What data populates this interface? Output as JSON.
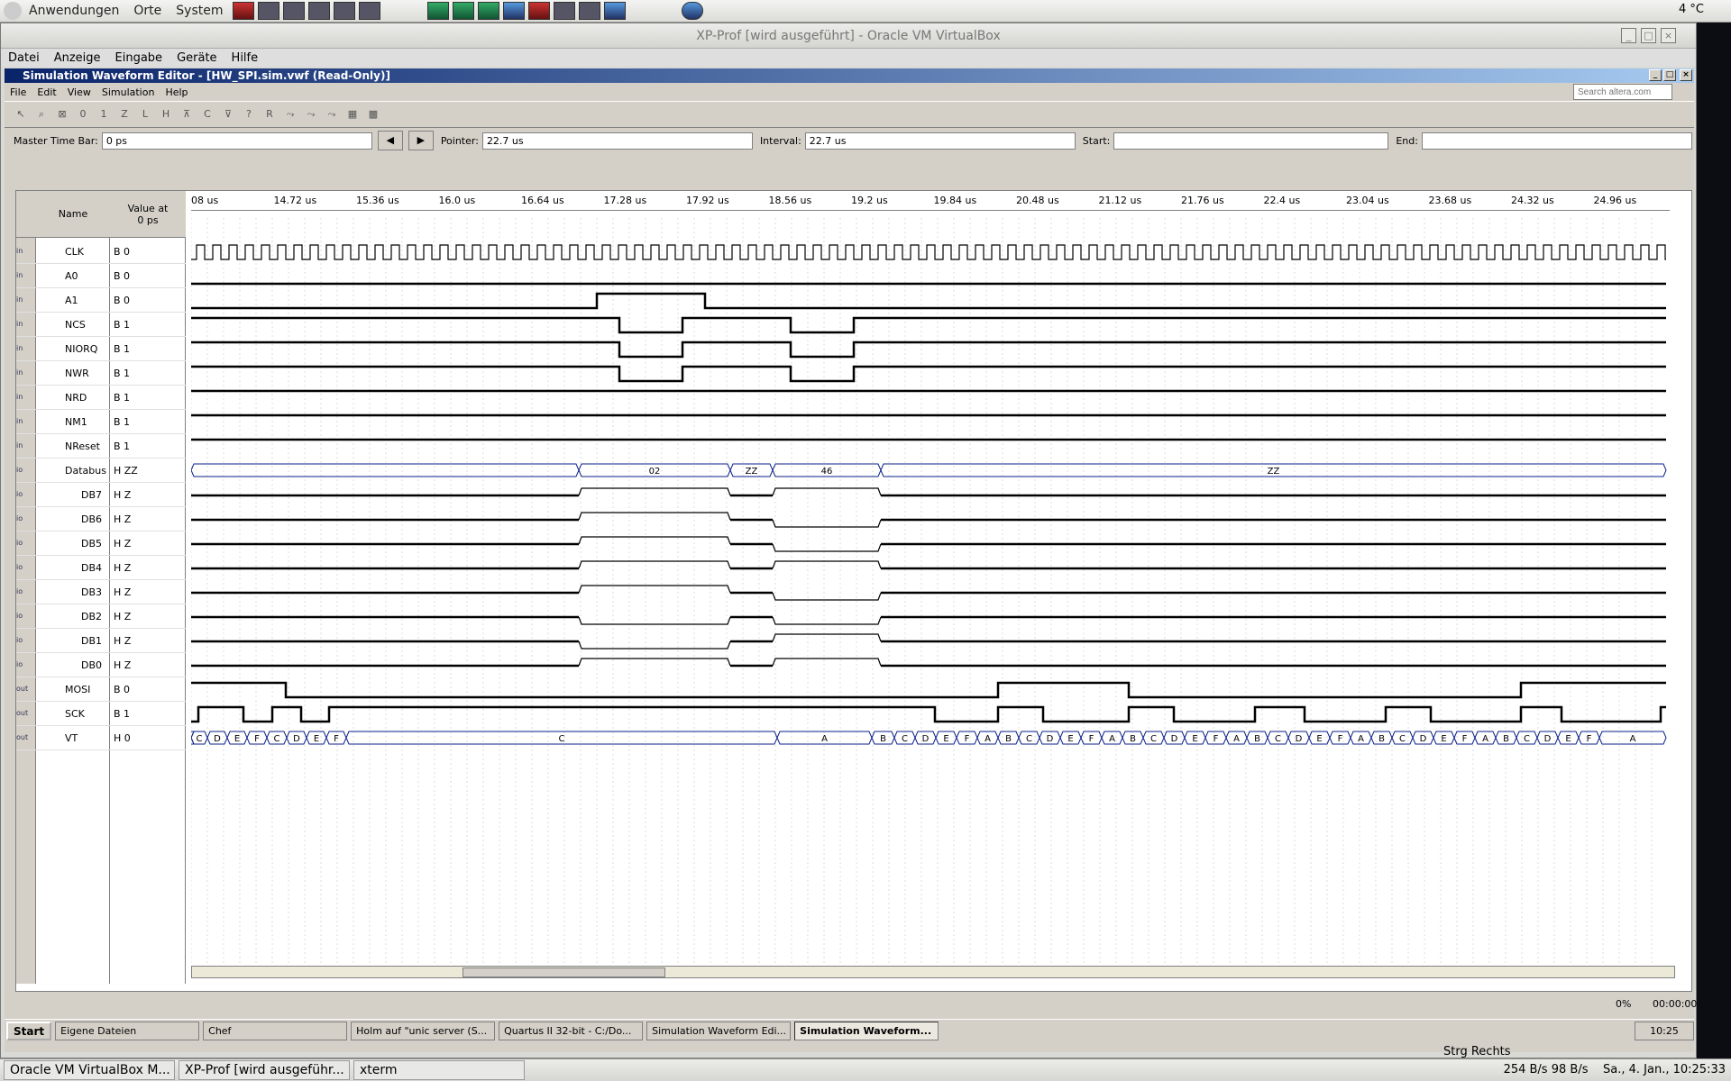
{
  "gnome_top": {
    "menus": [
      "Anwendungen",
      "Orte",
      "System"
    ],
    "weather": "4 °C"
  },
  "vbox": {
    "title": "XP-Prof [wird ausgeführt] - Oracle VM VirtualBox",
    "menu": [
      "Datei",
      "Anzeige",
      "Eingabe",
      "Geräte",
      "Hilfe"
    ],
    "status_right": "Strg Rechts"
  },
  "app": {
    "title": "Simulation Waveform Editor - [HW_SPI.sim.vwf (Read-Only)]",
    "menu": [
      "File",
      "Edit",
      "View",
      "Simulation",
      "Help"
    ],
    "search_placeholder": "Search altera.com"
  },
  "timebar": {
    "master_label": "Master Time Bar:",
    "master_value": "0 ps",
    "pointer_label": "Pointer:",
    "pointer_value": "22.7 us",
    "interval_label": "Interval:",
    "interval_value": "22.7 us",
    "start_label": "Start:",
    "end_label": "End:"
  },
  "table": {
    "name_header": "Name",
    "value_header": "Value at\n0 ps"
  },
  "ruler": [
    "08 us",
    "14.72 us",
    "15.36 us",
    "16.0 us",
    "16.64 us",
    "17.28 us",
    "17.92 us",
    "18.56 us",
    "19.2 us",
    "19.84 us",
    "20.48 us",
    "21.12 us",
    "21.76 us",
    "22.4 us",
    "23.04 us",
    "23.68 us",
    "24.32 us",
    "24.96 us"
  ],
  "signals": [
    {
      "name": "CLK",
      "value": "B 0",
      "dir": "in"
    },
    {
      "name": "A0",
      "value": "B 0",
      "dir": "in"
    },
    {
      "name": "A1",
      "value": "B 0",
      "dir": "in"
    },
    {
      "name": "NCS",
      "value": "B 1",
      "dir": "in"
    },
    {
      "name": "NIORQ",
      "value": "B 1",
      "dir": "in"
    },
    {
      "name": "NWR",
      "value": "B 1",
      "dir": "in"
    },
    {
      "name": "NRD",
      "value": "B 1",
      "dir": "in"
    },
    {
      "name": "NM1",
      "value": "B 1",
      "dir": "in"
    },
    {
      "name": "NReset",
      "value": "B 1",
      "dir": "in"
    },
    {
      "name": "Databus",
      "value": "H ZZ",
      "dir": "io"
    },
    {
      "name": "DB7",
      "value": "H Z",
      "dir": "io"
    },
    {
      "name": "DB6",
      "value": "H Z",
      "dir": "io"
    },
    {
      "name": "DB5",
      "value": "H Z",
      "dir": "io"
    },
    {
      "name": "DB4",
      "value": "H Z",
      "dir": "io"
    },
    {
      "name": "DB3",
      "value": "H Z",
      "dir": "io"
    },
    {
      "name": "DB2",
      "value": "H Z",
      "dir": "io"
    },
    {
      "name": "DB1",
      "value": "H Z",
      "dir": "io"
    },
    {
      "name": "DB0",
      "value": "H Z",
      "dir": "io"
    },
    {
      "name": "MOSI",
      "value": "B 0",
      "dir": "out"
    },
    {
      "name": "SCK",
      "value": "B 1",
      "dir": "out"
    },
    {
      "name": "VT",
      "value": "H 0",
      "dir": "out"
    }
  ],
  "bus_labels": {
    "databus": [
      "02",
      "ZZ",
      "46",
      "ZZ"
    ],
    "vt_segments": [
      "C",
      "D",
      "E",
      "F",
      "C",
      "D",
      "E",
      "F",
      "C",
      "A",
      "B",
      "C",
      "D",
      "E",
      "F",
      "A",
      "B",
      "C",
      "D",
      "E",
      "F",
      "A",
      "B",
      "C",
      "D",
      "E",
      "F",
      "A",
      "B",
      "C",
      "D",
      "E",
      "F",
      "A",
      "B",
      "C",
      "D",
      "E",
      "F",
      "A",
      "B",
      "C",
      "D",
      "E",
      "F",
      "A"
    ]
  },
  "status": {
    "progress": "0%",
    "time": "00:00:00"
  },
  "xp_taskbar": {
    "start": "Start",
    "tasks": [
      "Eigene Dateien",
      "Chef",
      "Holm auf \"unic server (S...",
      "Quartus II 32-bit - C:/Do...",
      "Simulation Waveform Edi...",
      "Simulation Waveform..."
    ],
    "active_index": 5,
    "clock": "10:25"
  },
  "gnome_bottom": {
    "tasks": [
      "Oracle VM VirtualBox M...",
      "XP-Prof [wird ausgeführ...",
      "xterm"
    ],
    "net_down": "254 B/s",
    "net_up": "98 B/s",
    "clock": "Sa.,  4. Jan., 10:25:33"
  }
}
